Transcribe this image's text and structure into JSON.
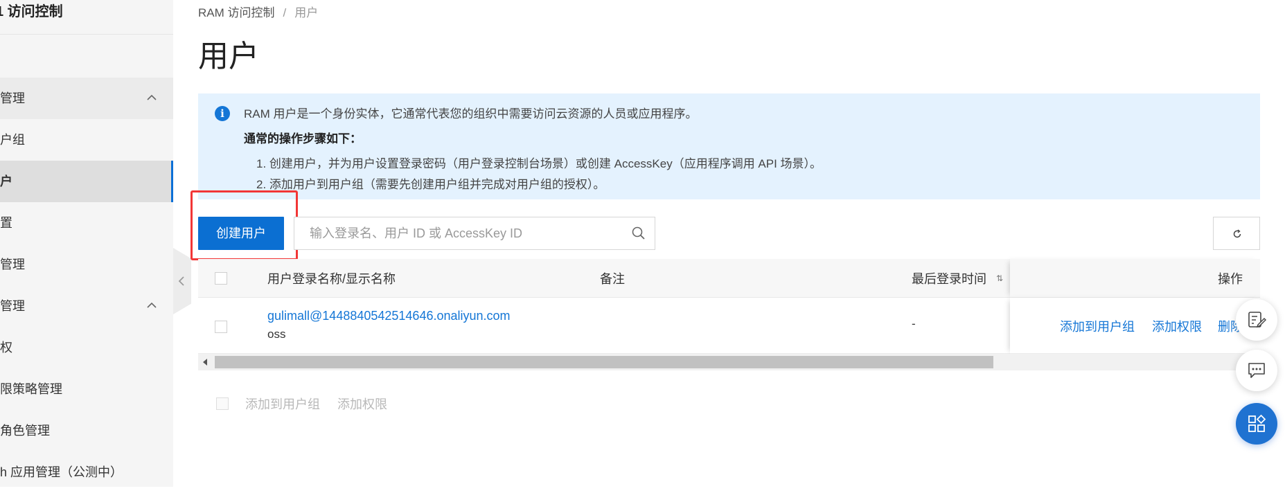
{
  "sidebar": {
    "title": "1 访问控制",
    "items": [
      {
        "label": "管理",
        "type": "group"
      },
      {
        "label": "户组",
        "type": "item"
      },
      {
        "label": "户",
        "type": "active"
      },
      {
        "label": "置",
        "type": "item"
      },
      {
        "label": "管理",
        "type": "item"
      },
      {
        "label": "管理",
        "type": "group"
      },
      {
        "label": "权",
        "type": "item"
      },
      {
        "label": "限策略管理",
        "type": "item"
      },
      {
        "label": " 角色管理",
        "type": "item"
      },
      {
        "label": "h 应用管理（公测中）",
        "type": "item"
      }
    ]
  },
  "breadcrumb": {
    "root": "RAM 访问控制",
    "separator": "/",
    "current": "用户"
  },
  "page_title": "用户",
  "notice": {
    "line1": "RAM 用户是一个身份实体，它通常代表您的组织中需要访问云资源的人员或应用程序。",
    "line2": "通常的操作步骤如下：",
    "step1": "1. 创建用户，并为用户设置登录密码（用户登录控制台场景）或创建 AccessKey（应用程序调用 API 场景）。",
    "step2": "2. 添加用户到用户组（需要先创建用户组并完成对用户组的授权）。"
  },
  "toolbar": {
    "create_label": "创建用户",
    "search_placeholder": "输入登录名、用户 ID 或 AccessKey ID"
  },
  "table": {
    "columns": {
      "name": "用户登录名称/显示名称",
      "remark": "备注",
      "last_login": "最后登录时间",
      "sort_glyph": "⇅",
      "actions": "操作"
    },
    "rows": [
      {
        "login_name": "gulimall@1448840542514646.onaliyun.com",
        "display_name": "oss",
        "remark": "",
        "last_login": "-",
        "action_add_group": "添加到用户组",
        "action_add_perm": "添加权限",
        "action_delete": "删除"
      }
    ]
  },
  "bulk_actions": {
    "add_group": "添加到用户组",
    "add_perm": "添加权限"
  },
  "colors": {
    "primary": "#0b6fd2",
    "notice_bg": "#e4f2fe",
    "highlight": "#f23636",
    "link": "#1476d6"
  }
}
